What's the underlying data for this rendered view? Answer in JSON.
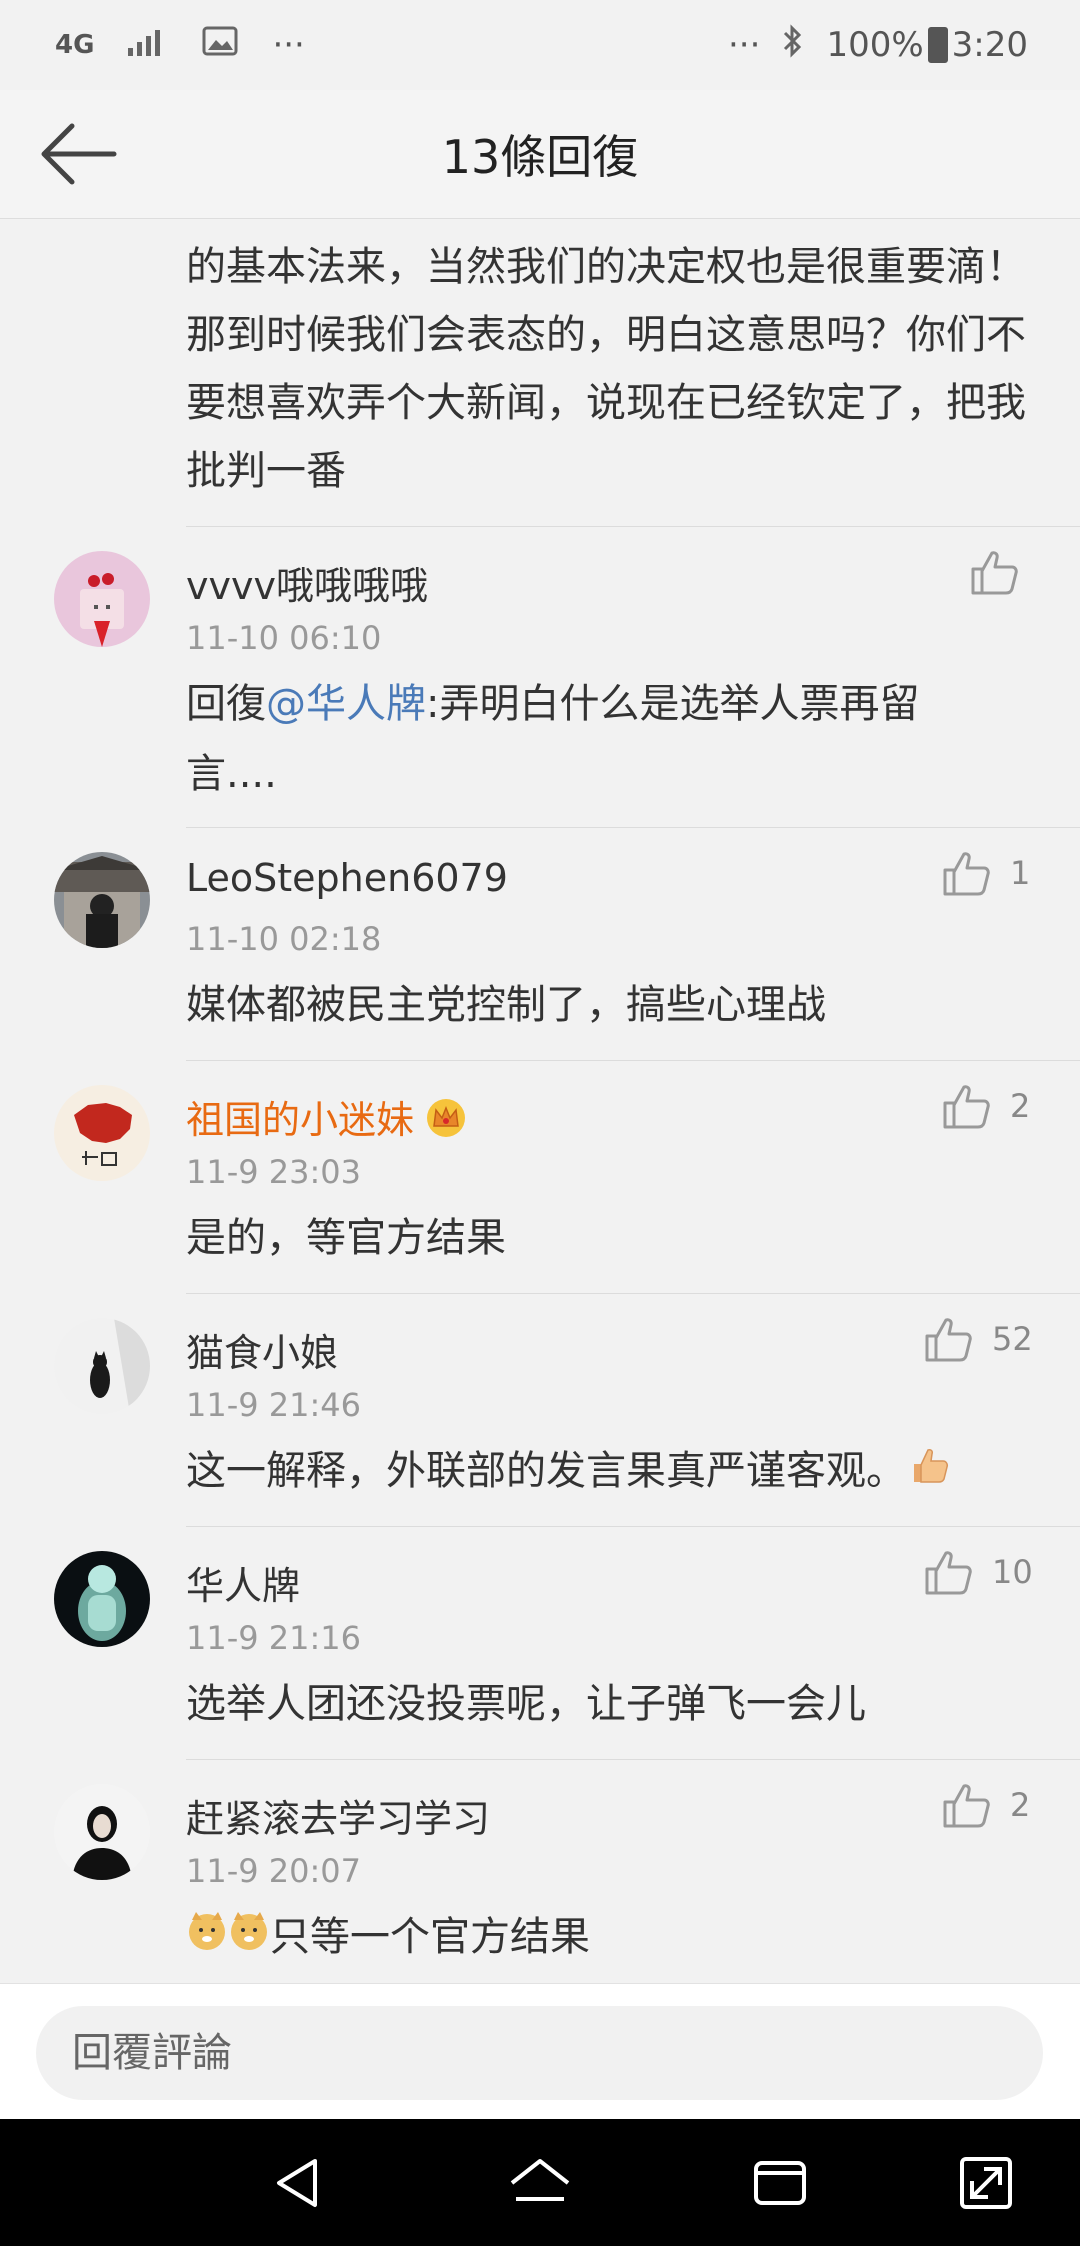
{
  "status_bar": {
    "network": "4G",
    "more": "···",
    "more_right": "···",
    "battery": "100%",
    "time": "3:20"
  },
  "header": {
    "title": "13條回復"
  },
  "continued_comment": {
    "text": "但是没有任何要改定的意思，这还是要按照美国的基本法来，当然我们的决定权也是很重要滴！那到时候我们会表态的，明白这意思吗？你们不要想喜欢弄个大新闻，说现在已经钦定了，把我批判一番"
  },
  "comments": [
    {
      "user": "vvvv哦哦哦哦",
      "time": "11-10 06:10",
      "reply_prefix": "回復",
      "mention": "@华人牌",
      "text": ":弄明白什么是选举人票再留言....",
      "likes": "",
      "avatar_icon": "cake-avatar"
    },
    {
      "user": "LeoStephen6079",
      "time": "11-10 02:18",
      "text": "媒体都被民主党控制了，搞些心理战",
      "likes": "1",
      "avatar_icon": "building-avatar"
    },
    {
      "user": "祖国的小迷妹",
      "time": "11-9 23:03",
      "text": "是的，等官方结果",
      "likes": "2",
      "avatar_icon": "china-map-avatar",
      "badge_icon": "crown-icon"
    },
    {
      "user": "猫食小娘",
      "time": "11-9 21:46",
      "text": "这一解释，外联部的发言果真严谨客观。",
      "emoji_icon": "thumbs-up-emoji",
      "likes": "52",
      "avatar_icon": "cat-avatar"
    },
    {
      "user": "华人牌",
      "time": "11-9 21:16",
      "text": "选举人团还没投票呢，让子弹飞一会儿",
      "likes": "10",
      "avatar_icon": "ice-figure-avatar"
    },
    {
      "user": "赶紧滚去学习学习",
      "time": "11-9 20:07",
      "text": "只等一个官方结果",
      "emoji_icon": "doge-emoji",
      "likes": "2",
      "avatar_icon": "portrait-avatar"
    }
  ],
  "reply_bar": {
    "placeholder": "回覆評論"
  },
  "colors": {
    "background": "#f2f2f2",
    "mention": "#4a7ab8",
    "vip_name": "#e86a12",
    "timestamp": "#999999"
  }
}
